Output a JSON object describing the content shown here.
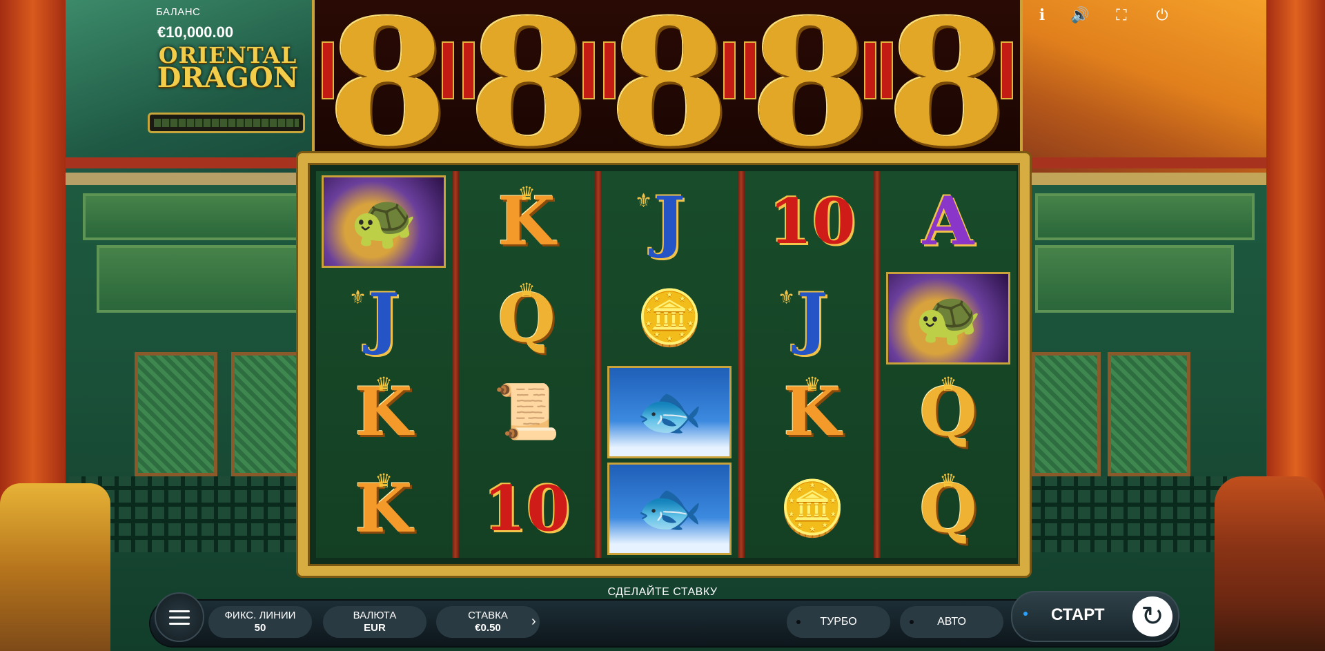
{
  "hud": {
    "balance_label": "БАЛАНС",
    "balance_value": "€10,000.00",
    "logo_line1": "ORIENTAL",
    "logo_line2": "DRAGON"
  },
  "top_icons": [
    "info-icon",
    "sound-icon",
    "fullscreen-icon",
    "power-icon"
  ],
  "jackpot_eights": [
    "8",
    "8",
    "8",
    "8",
    "8"
  ],
  "reels": [
    [
      {
        "type": "turtle"
      },
      {
        "type": "J"
      },
      {
        "type": "K"
      },
      {
        "type": "K"
      }
    ],
    [
      {
        "type": "K"
      },
      {
        "type": "Q"
      },
      {
        "type": "scroll"
      },
      {
        "type": "10"
      }
    ],
    [
      {
        "type": "J"
      },
      {
        "type": "coins"
      },
      {
        "type": "fish"
      },
      {
        "type": "fish"
      }
    ],
    [
      {
        "type": "10"
      },
      {
        "type": "J"
      },
      {
        "type": "K"
      },
      {
        "type": "coins"
      }
    ],
    [
      {
        "type": "A"
      },
      {
        "type": "turtle"
      },
      {
        "type": "Q"
      },
      {
        "type": "Q"
      }
    ]
  ],
  "controls": {
    "bet_hint": "СДЕЛАЙТЕ СТАВКУ",
    "lines_label": "ФИКС. ЛИНИИ",
    "lines_value": "50",
    "currency_label": "ВАЛЮТА",
    "currency_value": "EUR",
    "bet_label": "СТАВКА",
    "bet_value": "€0.50",
    "turbo_label": "ТУРБО",
    "auto_label": "АВТО",
    "start_label": "СТАРТ"
  },
  "colors": {
    "frame_gold": "#d7ac40",
    "pillar_red": "#d95a1d",
    "bar_dark": "#1d2e36"
  }
}
